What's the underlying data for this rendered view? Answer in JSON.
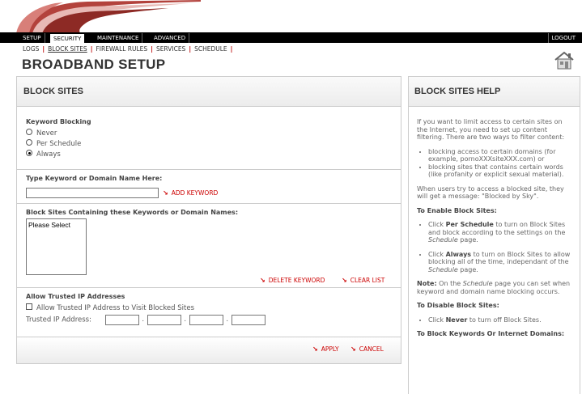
{
  "nav": {
    "tabs": [
      {
        "label": "SETUP"
      },
      {
        "label": "SECURITY"
      },
      {
        "label": "MAINTENANCE"
      },
      {
        "label": "ADVANCED"
      }
    ],
    "logout": "LOGOUT"
  },
  "subnav": {
    "items": [
      {
        "label": "LOGS"
      },
      {
        "label": "BLOCK SITES"
      },
      {
        "label": "FIREWALL RULES"
      },
      {
        "label": "SERVICES"
      },
      {
        "label": "SCHEDULE"
      }
    ]
  },
  "page_title": "BROADBAND SETUP",
  "main": {
    "heading": "BLOCK SITES",
    "keyword_blocking": {
      "label": "Keyword Blocking",
      "options": [
        "Never",
        "Per Schedule",
        "Always"
      ],
      "selected": "Always"
    },
    "keyword_entry": {
      "label": "Type Keyword or Domain Name Here:",
      "value": "",
      "add_label": "ADD KEYWORD"
    },
    "block_list": {
      "label": "Block Sites Containing these Keywords or Domain Names:",
      "items": [
        "Please Select"
      ],
      "delete_label": "DELETE KEYWORD",
      "clear_label": "CLEAR LIST"
    },
    "trusted": {
      "label": "Allow Trusted IP Addresses",
      "checkbox_label": "Allow Trusted IP Address to Visit Blocked Sites",
      "checked": false,
      "ip_label": "Trusted IP Address:",
      "ip": [
        "",
        "",
        "",
        ""
      ]
    },
    "apply_label": "APPLY",
    "cancel_label": "CANCEL"
  },
  "help": {
    "heading": "BLOCK SITES HELP",
    "intro": "If you want to limit access to certain sites on the Internet, you need to set up content filtering. There are two ways to filter content:",
    "ways": [
      "blocking access to certain domains (for example, pornoXXXsiteXXX.com) or",
      "blocking sites that contains certain words (like profanity or explicit sexual material)."
    ],
    "message_note": "When users try to access a blocked site, they will get a message: \"Blocked by Sky\".",
    "enable_heading": "To Enable Block Sites:",
    "enable_1_pre": "Click ",
    "enable_1_bold": "Per Schedule",
    "enable_1_post": " to turn on Block Sites and block according to the settings on the ",
    "enable_1_em": "Schedule",
    "enable_1_end": " page.",
    "enable_2_pre": "Click ",
    "enable_2_bold": "Always",
    "enable_2_post": " to turn on Block Sites to allow blocking all of the time, independant of the ",
    "enable_2_em": "Schedule",
    "enable_2_end": " page.",
    "note_bold": "Note:",
    "note_pre": " On the ",
    "note_em": "Schedule",
    "note_post": " page you can set when keyword and domain name blocking occurs.",
    "disable_heading": "To Disable Block Sites:",
    "disable_pre": "Click ",
    "disable_bold": "Never",
    "disable_post": " to turn off Block Sites.",
    "block_heading": "To Block Keywords Or Internet Domains:"
  }
}
